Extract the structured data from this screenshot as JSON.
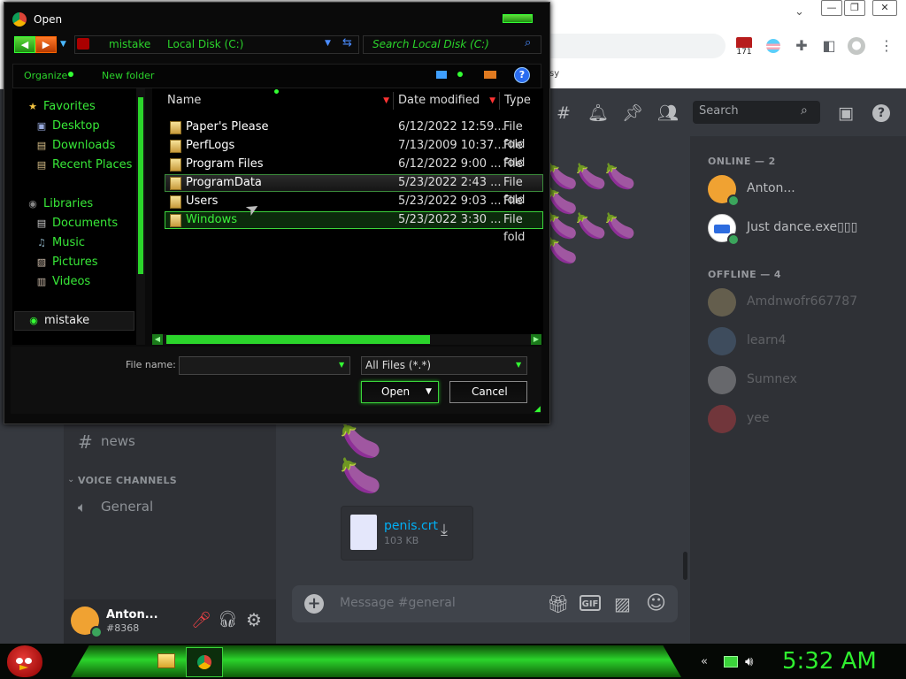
{
  "dialog": {
    "title": "Open",
    "address_path": [
      "mistake",
      "Local Disk (C:)"
    ],
    "search_placeholder": "Search Local Disk (C:)",
    "toolbar": {
      "organize": "Organize",
      "new_folder": "New folder"
    },
    "nav": {
      "favorites_label": "Favorites",
      "favorites": [
        "Desktop",
        "Downloads",
        "Recent Places"
      ],
      "libraries_label": "Libraries",
      "libraries": [
        "Documents",
        "Music",
        "Pictures",
        "Videos"
      ],
      "computer_label": "mistake"
    },
    "columns": {
      "name": "Name",
      "date": "Date modified",
      "type": "Type"
    },
    "files": [
      {
        "name": "Paper's Please",
        "date": "6/12/2022 12:59...",
        "type": "File fold"
      },
      {
        "name": "PerfLogs",
        "date": "7/13/2009 10:37...",
        "type": "File fold"
      },
      {
        "name": "Program Files",
        "date": "6/12/2022 9:00 ...",
        "type": "File fold"
      },
      {
        "name": "ProgramData",
        "date": "5/23/2022 2:43 ...",
        "type": "File fold"
      },
      {
        "name": "Users",
        "date": "5/23/2022 9:03 ...",
        "type": "File fold"
      },
      {
        "name": "Windows",
        "date": "5/23/2022 3:30 ...",
        "type": "File fold"
      }
    ],
    "file_name_label": "File name:",
    "file_name_value": "",
    "filter_value": "All Files (*.*)",
    "open_label": "Open",
    "cancel_label": "Cancel"
  },
  "chrome": {
    "bookmark_fragment": "sy",
    "badge_count": "171"
  },
  "discord": {
    "search_label": "Search",
    "online_header": "ONLINE — 2",
    "offline_header": "OFFLINE — 4",
    "online_members": [
      "Anton...",
      "Just dance.exe▯▯▯"
    ],
    "offline_members": [
      "Amdnwofr667787",
      "learn4",
      "Sumnex",
      "yee"
    ],
    "channels": {
      "news": "news",
      "voice_header": "VOICE CHANNELS",
      "general": "General"
    },
    "user": {
      "name": "Anton...",
      "tag": "#8368"
    },
    "attachment": {
      "name": "penis.crt",
      "size": "103 KB"
    },
    "message_placeholder": "Message #general",
    "gif_label": "GIF",
    "colors": {
      "blurple": "#5865f2",
      "online": "#3ba55c",
      "bg": "#36393f"
    }
  },
  "taskbar": {
    "clock": "5:32 AM"
  }
}
